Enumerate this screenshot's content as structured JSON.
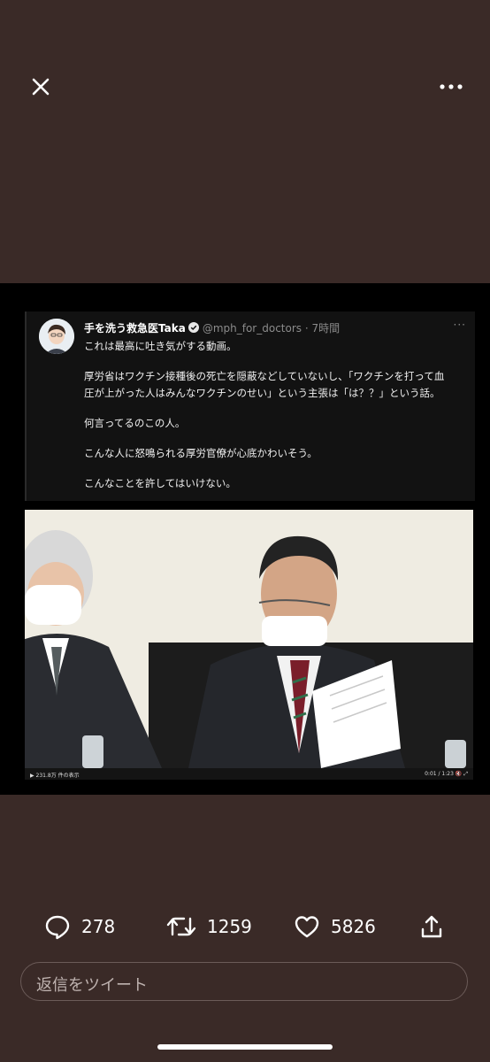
{
  "top_bar": {
    "close_icon": "close-icon",
    "more_icon": "more-horizontal-icon"
  },
  "tweet": {
    "name": "手を洗う救急医Taka",
    "handle": "@mph_for_doctors",
    "time": "· 7時間",
    "more": "···",
    "lines": [
      "これは最高に吐き気がする動画。",
      "厚労省はワクチン接種後の死亡を隠蔽などしていないし、「ワクチンを打って血",
      "圧が上がった人はみんなワクチンのせい」という主張は「は？？」という話。",
      "何言ってるのこの人。",
      "こんな人に怒鳴られる厚労官僚が心底かわいそう。",
      "こんなことを許してはいけない。"
    ]
  },
  "video": {
    "views": "231.8万 件の表示",
    "time": "0:01 / 1:23"
  },
  "actions": {
    "reply_count": "278",
    "retweet_count": "1259",
    "like_count": "5826"
  },
  "reply": {
    "placeholder": "返信をツイート"
  },
  "colors": {
    "background": "#3a2a27",
    "text": "#ffffff"
  }
}
